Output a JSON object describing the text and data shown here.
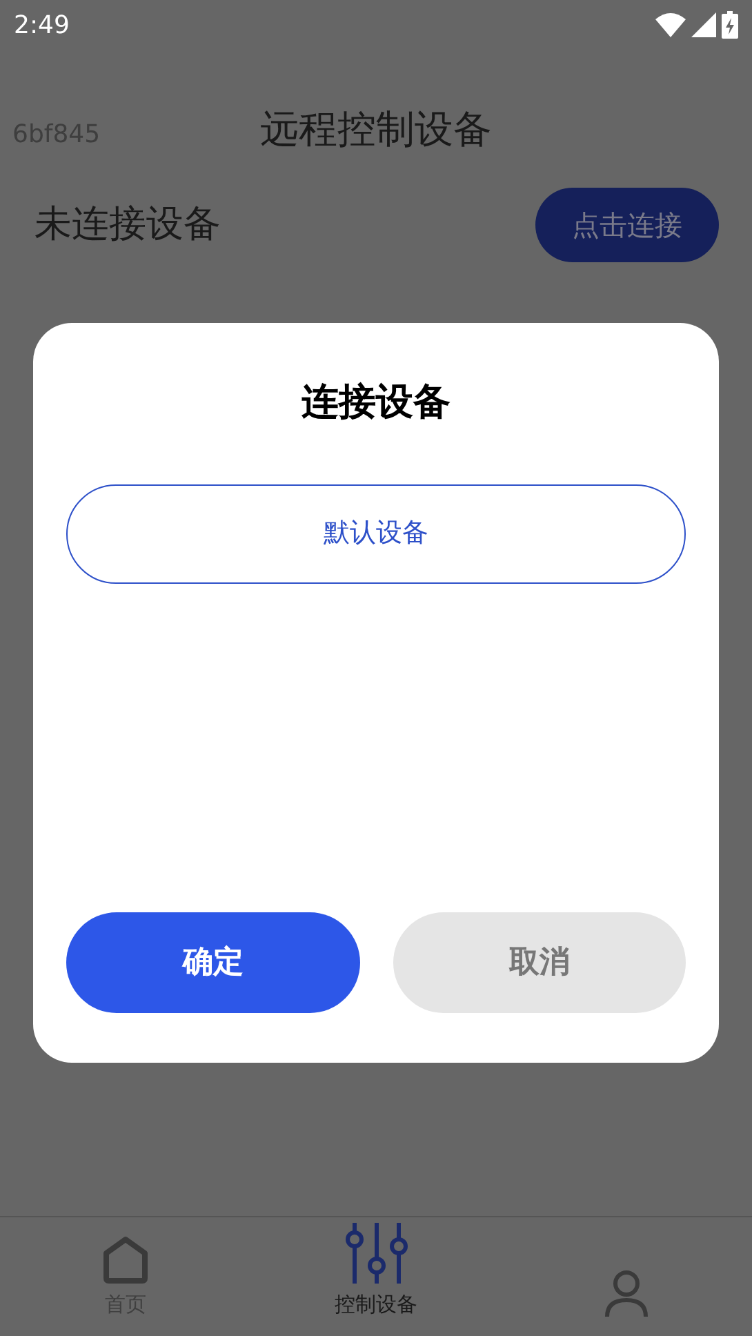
{
  "status_bar": {
    "time": "2:49"
  },
  "header": {
    "id_text": "6bf845",
    "title": "远程控制设备"
  },
  "connection": {
    "status": "未连接设备",
    "button": "点击连接"
  },
  "dialog": {
    "title": "连接设备",
    "devices": [
      {
        "label": "默认设备",
        "selected": true
      }
    ],
    "buttons": [
      {
        "label": "确定",
        "kind": "primary"
      },
      {
        "label": "取消",
        "kind": "secondary"
      }
    ]
  },
  "tabs": [
    {
      "label": "首页",
      "kind": "home",
      "selected": false
    },
    {
      "label": "控制设备",
      "kind": "control",
      "selected": true
    },
    {
      "kind": "profile",
      "selected": false
    }
  ]
}
